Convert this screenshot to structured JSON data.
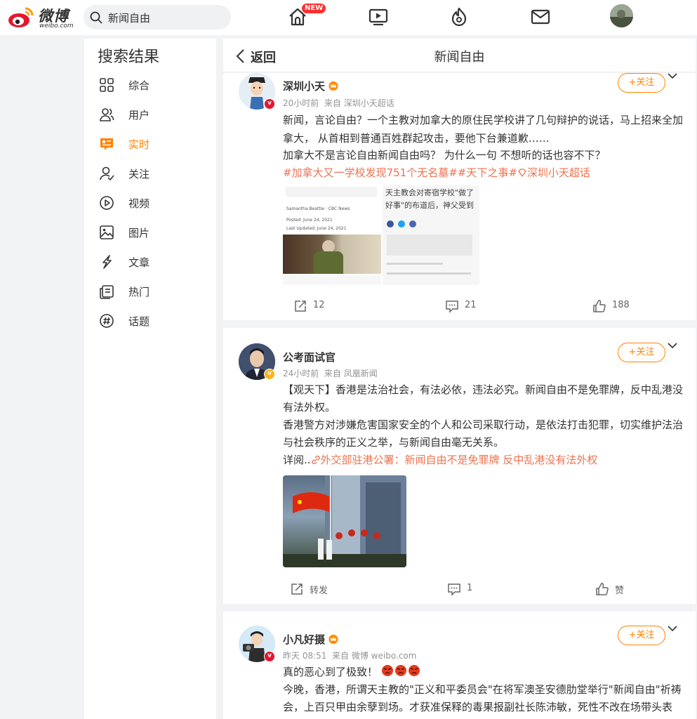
{
  "brand": {
    "name": "微博",
    "domain": "weibo.com"
  },
  "search": {
    "query": "新闻自由"
  },
  "nav": {
    "new_badge": "NEW"
  },
  "colors": {
    "accent": "#ff8200",
    "topic": "#eb7350",
    "verified_gold": "#f8b51e",
    "verified_red": "#e6162d"
  },
  "sidebar": {
    "title": "搜索结果",
    "items": [
      {
        "label": "综合",
        "icon": "grid-icon"
      },
      {
        "label": "用户",
        "icon": "users-icon"
      },
      {
        "label": "实时",
        "icon": "realtime-icon",
        "active": true
      },
      {
        "label": "关注",
        "icon": "follow-icon"
      },
      {
        "label": "视频",
        "icon": "video-icon"
      },
      {
        "label": "图片",
        "icon": "image-icon"
      },
      {
        "label": "文章",
        "icon": "article-icon"
      },
      {
        "label": "热门",
        "icon": "hot-icon"
      },
      {
        "label": "话题",
        "icon": "topic-icon"
      }
    ]
  },
  "header": {
    "back_label": "返回",
    "title": "新闻自由"
  },
  "posts": [
    {
      "user": "深圳小天",
      "time": "20小时前",
      "source": "来自 深圳小天超话",
      "follow_label": "+关注",
      "lines": [
        "新闻，言论自由？一个主教对加拿大的原住民学校讲了几句辩护的说话，马上招来全加",
        "拿大， 从首相到普通百姓群起攻击，要他下台兼道歉……",
        "加拿大不是言论自由新闻自由吗？ 为什么一句 不想听的话也容不下？"
      ],
      "topics": "#加拿大又一学校发现751个无名墓##天下之事#",
      "supertopic": "深圳小天超话",
      "image1_text": [
        "Samantha Beattie · CBC News",
        "Posted: June 24, 2021",
        "Last Updated: June 24, 2021"
      ],
      "image2_text": [
        "天主教会对寄宿学校\"做了",
        "好事\"的布道后，神父受到"
      ],
      "reposts": "12",
      "comments": "21",
      "likes": "188"
    },
    {
      "user": "公考面试官",
      "time": "24小时前",
      "source": "来自 凤凰新闻",
      "follow_label": "+关注",
      "lines": [
        "【观天下】香港是法治社会，有法必依，违法必究。新闻自由不是免罪牌，反中乱港没",
        "有法外权。",
        "香港警方对涉嫌危害国家安全的个人和公司采取行动，是依法打击犯罪，切实维护法治",
        "与社会秩序的正义之举，与新闻自由毫无关系。"
      ],
      "detail_prefix": "详阅..",
      "link_text": "外交部驻港公署：新闻自由不是免罪牌 反中乱港没有法外权",
      "reposts": "转发",
      "comments": "1",
      "likes": "赞"
    },
    {
      "user": "小凡好摄",
      "time": "昨天 08:51",
      "source": "来自 微博 weibo.com",
      "follow_label": "+关注",
      "lines": [
        "真的恶心到了极致！",
        "今晚，香港，所谓天主教的\"正义和平委员会\"在将军澳圣安德肋堂举行\"新闻自由\"祈祷",
        "会，上百只甲由余孽到场。才获准保释的毒果报副社长陈沛敏，死性不改在场带头表"
      ]
    }
  ]
}
